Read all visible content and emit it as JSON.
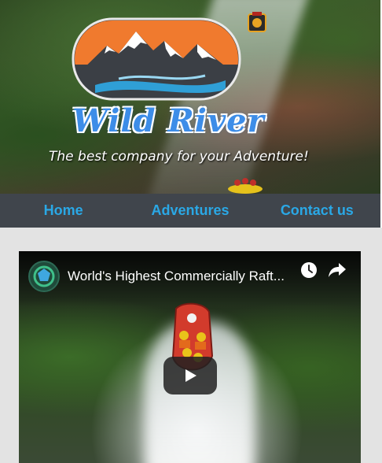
{
  "header": {
    "brand": "Wild River",
    "tagline": "The best company for your Adventure!"
  },
  "nav": {
    "items": [
      {
        "label": "Home"
      },
      {
        "label": "Adventures"
      },
      {
        "label": "Contact us"
      }
    ]
  },
  "video": {
    "title": "World's Highest Commercially Raft...",
    "icons": [
      "clock-icon",
      "share-icon",
      "play-icon"
    ]
  },
  "colors": {
    "nav_bg": "#40454c",
    "nav_link": "#2aa8e6",
    "brand_blue": "#3d8de8",
    "logo_orange": "#f07a2e",
    "logo_dark": "#3b3f45"
  }
}
